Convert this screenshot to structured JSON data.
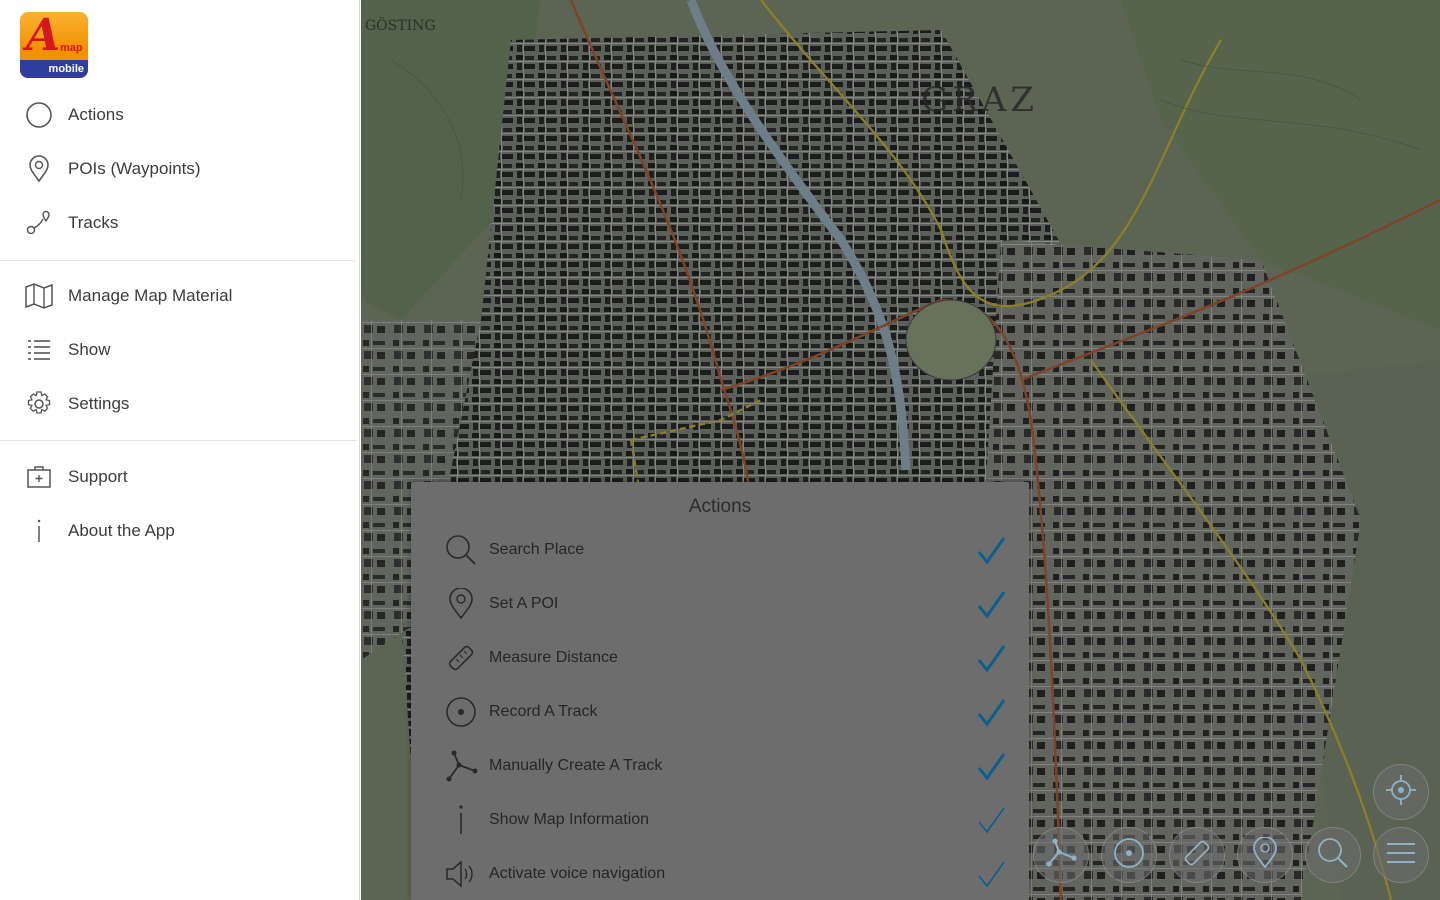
{
  "sidebar": {
    "logo": {
      "letter": "A",
      "map_text": "map",
      "bar_text": "mobile"
    },
    "group1": [
      {
        "label": "Actions",
        "icon": "circle-icon"
      },
      {
        "label": "POIs (Waypoints)",
        "icon": "pin-icon"
      },
      {
        "label": "Tracks",
        "icon": "tracks-icon"
      }
    ],
    "group2": [
      {
        "label": "Manage Map Material",
        "icon": "map-icon"
      },
      {
        "label": "Show",
        "icon": "list-icon"
      },
      {
        "label": "Settings",
        "icon": "gear-icon"
      }
    ],
    "group3": [
      {
        "label": "Support",
        "icon": "support-icon"
      },
      {
        "label": "About the App",
        "icon": "info-icon"
      }
    ]
  },
  "map": {
    "city_label": "GRAZ",
    "corner_label": "GÖSTING"
  },
  "actions_panel": {
    "title": "Actions",
    "items": [
      {
        "label": "Search Place",
        "icon": "search-icon",
        "checked": true
      },
      {
        "label": "Set A POI",
        "icon": "pin-icon",
        "checked": true
      },
      {
        "label": "Measure Distance",
        "icon": "ruler-icon",
        "checked": true
      },
      {
        "label": "Record A Track",
        "icon": "record-icon",
        "checked": true
      },
      {
        "label": "Manually Create A Track",
        "icon": "track-create-icon",
        "checked": true
      },
      {
        "label": "Show Map Information",
        "icon": "info-icon",
        "checked": true
      },
      {
        "label": "Activate voice navigation",
        "icon": "speaker-icon",
        "checked": true
      }
    ],
    "check_color": "#0a5f8c"
  },
  "toolbar": {
    "items": [
      "track-create-icon",
      "record-icon",
      "ruler-icon",
      "pin-icon",
      "search-icon",
      "menu-icon",
      "locate-icon"
    ]
  }
}
